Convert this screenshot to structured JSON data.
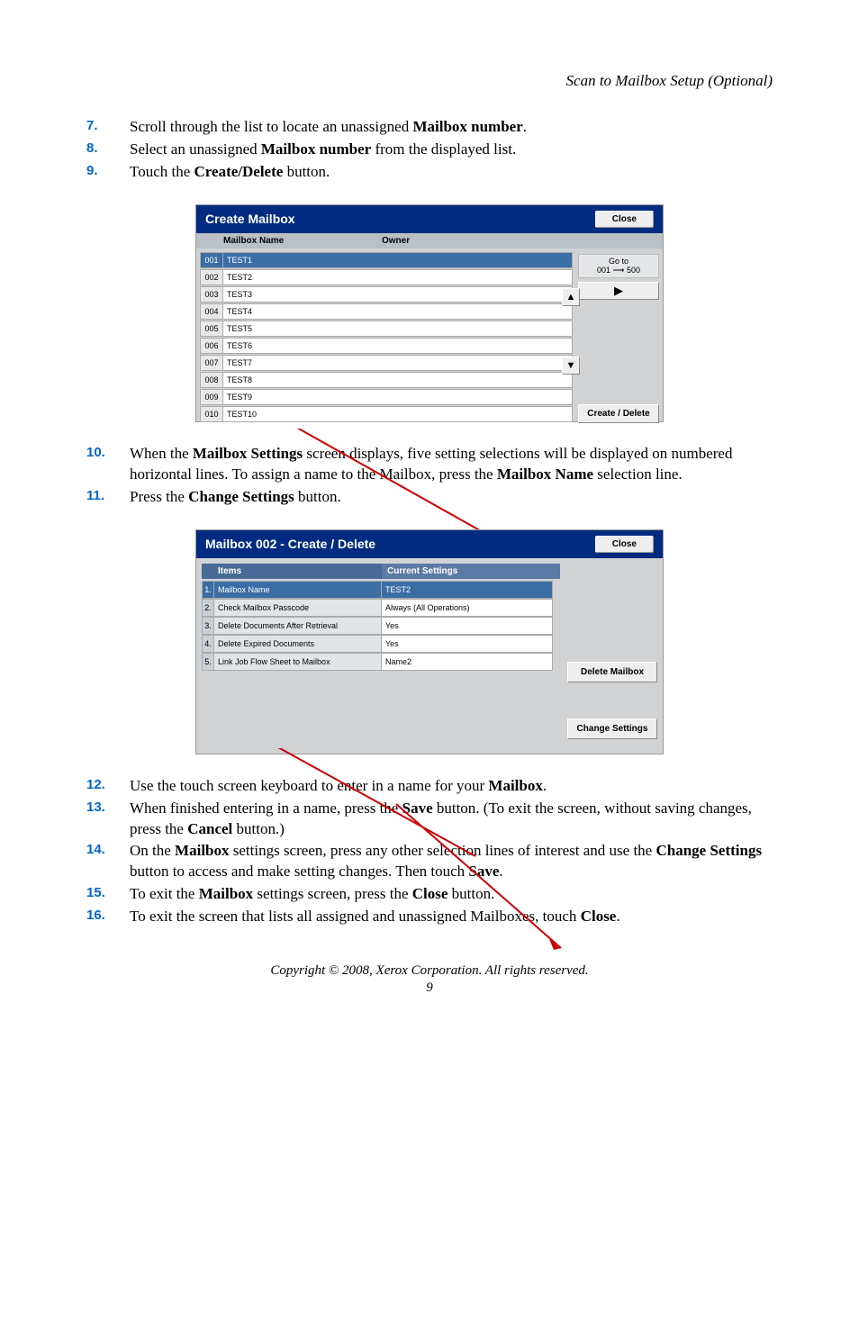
{
  "header": {
    "running_title": "Scan to Mailbox Setup (Optional)"
  },
  "steps_a": [
    {
      "n": "7.",
      "html": "Scroll through the list to locate an unassigned <b>Mailbox number</b>."
    },
    {
      "n": "8.",
      "html": "Select an unassigned <b>Mailbox number</b> from the displayed list."
    },
    {
      "n": "9.",
      "html": "Touch the <b>Create/Delete</b> button."
    }
  ],
  "fig1": {
    "title": "Create Mailbox",
    "close": "Close",
    "col1": "Mailbox Name",
    "col2": "Owner",
    "rows": [
      {
        "num": "001",
        "name": "TEST1",
        "selected": true
      },
      {
        "num": "002",
        "name": "TEST2"
      },
      {
        "num": "003",
        "name": "TEST3"
      },
      {
        "num": "004",
        "name": "TEST4"
      },
      {
        "num": "005",
        "name": "TEST5"
      },
      {
        "num": "006",
        "name": "TEST6"
      },
      {
        "num": "007",
        "name": "TEST7"
      },
      {
        "num": "008",
        "name": "TEST8"
      },
      {
        "num": "009",
        "name": "TEST9"
      },
      {
        "num": "010",
        "name": "TEST10"
      }
    ],
    "goto_line1": "Go to",
    "goto_line2": "001 ⟶ 500",
    "create_delete": "Create / Delete"
  },
  "steps_b": [
    {
      "n": "10.",
      "html": "When the <b>Mailbox Settings</b> screen displays, five setting selections will be displayed on numbered horizontal lines. To assign a name to the Mailbox, press the <b>Mailbox Name</b> selection line."
    },
    {
      "n": "11.",
      "html": "Press the <b>Change Settings</b> button."
    }
  ],
  "fig2": {
    "title": "Mailbox 002 - Create / Delete",
    "close": "Close",
    "col_items": "Items",
    "col_cur": "Current Settings",
    "rows": [
      {
        "n": "1.",
        "label": "Mailbox Name",
        "val": "TEST2",
        "selected": true
      },
      {
        "n": "2.",
        "label": "Check Mailbox Passcode",
        "val": "Always (All Operations)"
      },
      {
        "n": "3.",
        "label": "Delete Documents After Retrieval",
        "val": "Yes"
      },
      {
        "n": "4.",
        "label": "Delete Expired Documents",
        "val": "Yes"
      },
      {
        "n": "5.",
        "label": "Link Job Flow Sheet to Mailbox",
        "val": "Name2"
      }
    ],
    "delete_mailbox": "Delete Mailbox",
    "change_settings": "Change Settings"
  },
  "steps_c": [
    {
      "n": "12.",
      "html": "Use the touch screen keyboard to enter in a name for your <b>Mailbox</b>."
    },
    {
      "n": "13.",
      "html": "When finished entering in a name, press the <b>Save</b> button. (To exit the screen, without saving changes, press the <b>Cancel</b> button.)"
    },
    {
      "n": "14.",
      "html": "On the <b>Mailbox</b> settings screen, press any other selection lines of interest and use the <b>Change Settings</b> button to access and make setting changes. Then touch <b>Save</b>."
    },
    {
      "n": "15.",
      "html": "To exit the <b>Mailbox</b> settings screen, press the <b>Close</b> button."
    },
    {
      "n": "16.",
      "html": "To exit the screen that lists all assigned and unassigned Mailboxes, touch <b>Close</b>."
    }
  ],
  "footer": {
    "copyright": "Copyright © 2008, Xerox Corporation. All rights reserved.",
    "page": "9"
  }
}
